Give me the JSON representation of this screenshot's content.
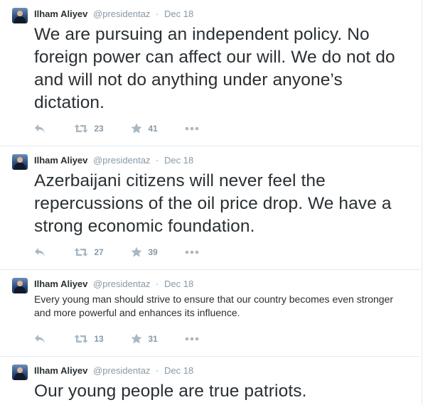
{
  "tweets": [
    {
      "author_name": "Ilham Aliyev",
      "handle": "@presidentaz",
      "separator": "·",
      "time": "Dec 18",
      "text": "We are pursuing an independent policy. No foreign power can affect our will. We do not do and will not do anything under anyone’s dictation.",
      "text_size": "large",
      "retweets": "23",
      "favorites": "41"
    },
    {
      "author_name": "Ilham Aliyev",
      "handle": "@presidentaz",
      "separator": "·",
      "time": "Dec 18",
      "text": "Azerbaijani citizens will never feel the repercussions of the oil price drop. We have a strong economic foundation.",
      "text_size": "large",
      "retweets": "27",
      "favorites": "39"
    },
    {
      "author_name": "Ilham Aliyev",
      "handle": "@presidentaz",
      "separator": "·",
      "time": "Dec 18",
      "text": "Every young man should strive to ensure that our country becomes even stronger and more powerful and enhances its influence.",
      "text_size": "small",
      "retweets": "13",
      "favorites": "31"
    },
    {
      "author_name": "Ilham Aliyev",
      "handle": "@presidentaz",
      "separator": "·",
      "time": "Dec 18",
      "text": "Our young people are true patriots.",
      "text_size": "large"
    }
  ],
  "icons": {
    "reply": "reply-icon",
    "retweet": "retweet-icon",
    "favorite": "star-icon",
    "more": "more-icon",
    "avatar": "avatar"
  },
  "colors": {
    "text": "#292f33",
    "muted": "#8899a6",
    "divider": "#e1e8ed",
    "action_icon": "#aab8c2"
  }
}
